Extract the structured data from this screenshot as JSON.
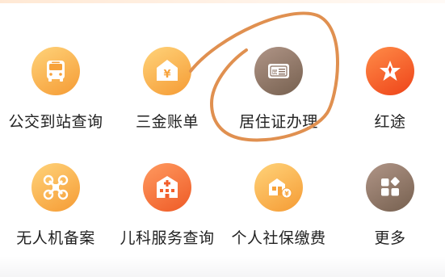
{
  "services": [
    {
      "label": "公交到站查询",
      "icon": "bus-icon",
      "color_from": "#ffcf6a",
      "color_to": "#f7a23a"
    },
    {
      "label": "三金账单",
      "icon": "yuan-house-icon",
      "color_from": "#ffcf6a",
      "color_to": "#f7a23a"
    },
    {
      "label": "居住证办理",
      "icon": "residence-card-icon",
      "color_from": "#a48a7c",
      "color_to": "#7f665a"
    },
    {
      "label": "红途",
      "icon": "red-star-icon",
      "color_from": "#ff7a3a",
      "color_to": "#f0471c"
    },
    {
      "label": "无人机备案",
      "icon": "drone-icon",
      "color_from": "#ffcf6a",
      "color_to": "#f7a23a"
    },
    {
      "label": "儿科服务查询",
      "icon": "hospital-icon",
      "color_from": "#ff8f5a",
      "color_to": "#f25f2c"
    },
    {
      "label": "个人社保缴费",
      "icon": "social-security-icon",
      "color_from": "#ffcf6a",
      "color_to": "#f7a23a"
    },
    {
      "label": "更多",
      "icon": "more-grid-icon",
      "color_from": "#a48a7c",
      "color_to": "#7f665a"
    }
  ],
  "annotation_color": "#e08a4a"
}
